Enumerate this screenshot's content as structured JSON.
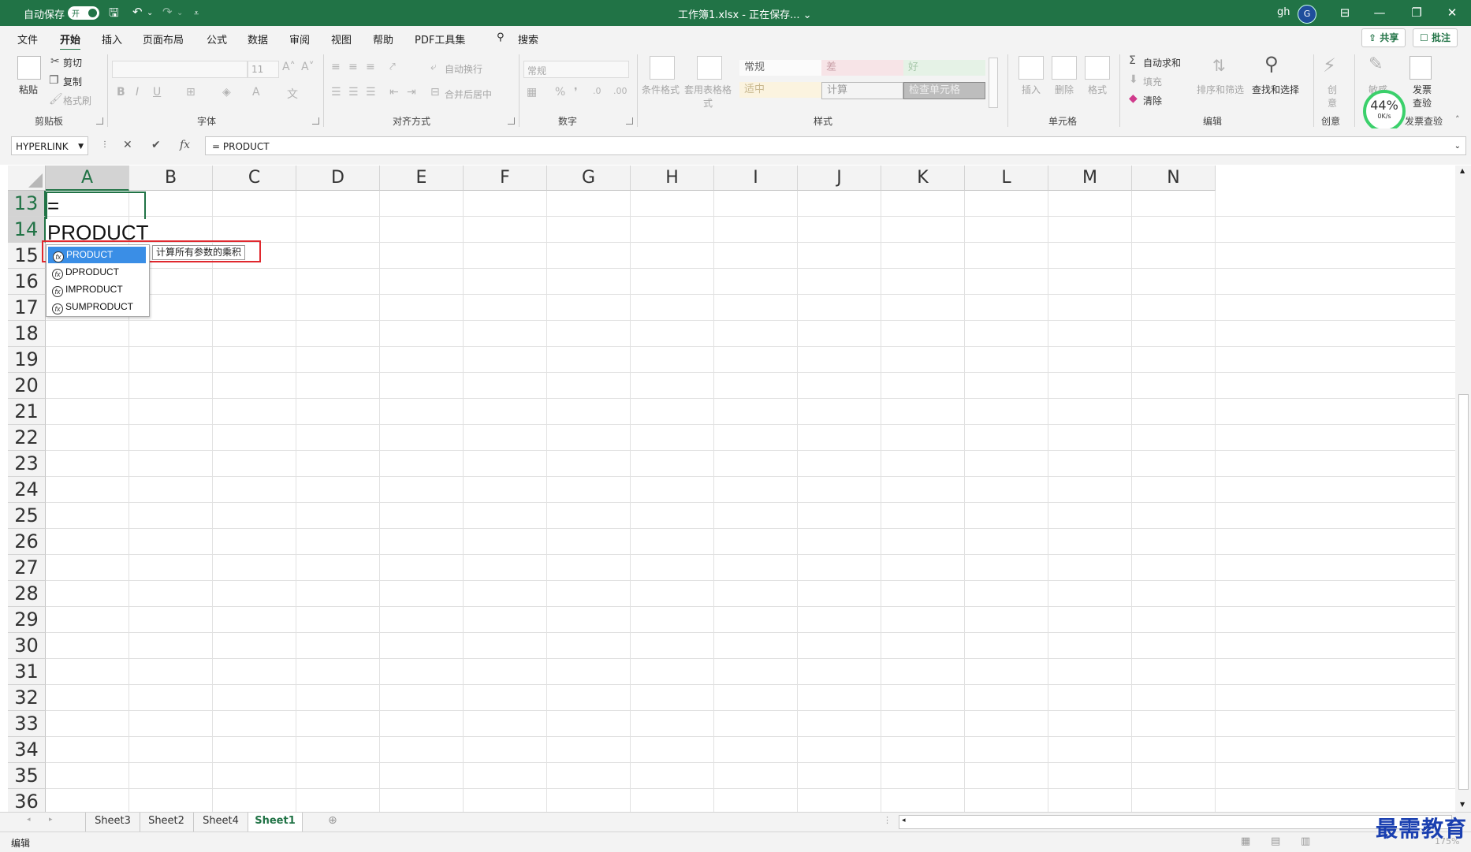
{
  "titlebar": {
    "autosave_label": "自动保存",
    "autosave_state": "开",
    "doc_title": "工作簿1.xlsx - 正在保存... ⌄",
    "user": "gh",
    "avatar_letter": "G",
    "accent_color": "#217346"
  },
  "menu": {
    "items": [
      "文件",
      "开始",
      "插入",
      "页面布局",
      "公式",
      "数据",
      "审阅",
      "视图",
      "帮助",
      "PDF工具集"
    ],
    "search": "搜索",
    "share": "共享",
    "comments": "批注"
  },
  "ribbon": {
    "clipboard": {
      "paste": "粘贴",
      "cut": "剪切",
      "copy": "复制",
      "format_painter": "格式刷",
      "label": "剪贴板"
    },
    "font": {
      "font_size": "11",
      "label": "字体",
      "bold": "B",
      "italic": "I",
      "underline": "U"
    },
    "alignment": {
      "wrap": "自动换行",
      "merge": "合并后居中",
      "label": "对齐方式"
    },
    "number": {
      "format": "常规",
      "label": "数字"
    },
    "styles": {
      "cond_format": "条件格式",
      "table_format": "套用表格格式",
      "cells": [
        "常规",
        "差",
        "好",
        "适中",
        "计算",
        "检查单元格"
      ],
      "label": "样式"
    },
    "cells": {
      "insert": "插入",
      "delete": "删除",
      "format": "格式",
      "label": "单元格"
    },
    "editing": {
      "autosum": "自动求和",
      "fill": "填充",
      "clear": "清除",
      "sort_filter": "排序和筛选",
      "find_select": "查找和选择",
      "label": "编辑"
    },
    "creative": {
      "label": "创意",
      "btn": "创意"
    },
    "invoice": {
      "btn": "发票查验",
      "label": "发票查验",
      "other": "敏感"
    },
    "meter": {
      "percent": "44%",
      "rate": "0K/s"
    }
  },
  "formula_bar": {
    "name_box": "HYPERLINK",
    "formula": "= PRODUCT"
  },
  "grid": {
    "columns": [
      "A",
      "B",
      "C",
      "D",
      "E",
      "F",
      "G",
      "H",
      "I",
      "J",
      "K",
      "L",
      "M",
      "N"
    ],
    "rows": [
      "13",
      "14",
      "15",
      "16",
      "17",
      "18",
      "19",
      "20",
      "21",
      "22",
      "23",
      "24",
      "25",
      "26",
      "27",
      "28",
      "29",
      "30",
      "31",
      "32",
      "33",
      "34",
      "35",
      "36"
    ],
    "cell_line1": "=",
    "cell_line2": "PRODUCT"
  },
  "autocomplete": {
    "items": [
      "PRODUCT",
      "DPRODUCT",
      "IMPRODUCT",
      "SUMPRODUCT"
    ],
    "tooltip": "计算所有参数的乘积"
  },
  "sheets": {
    "tabs": [
      "Sheet3",
      "Sheet2",
      "Sheet4",
      "Sheet1"
    ],
    "active": "Sheet1"
  },
  "status": {
    "mode": "编辑",
    "zoom": "175%"
  },
  "watermark": "最需教育"
}
